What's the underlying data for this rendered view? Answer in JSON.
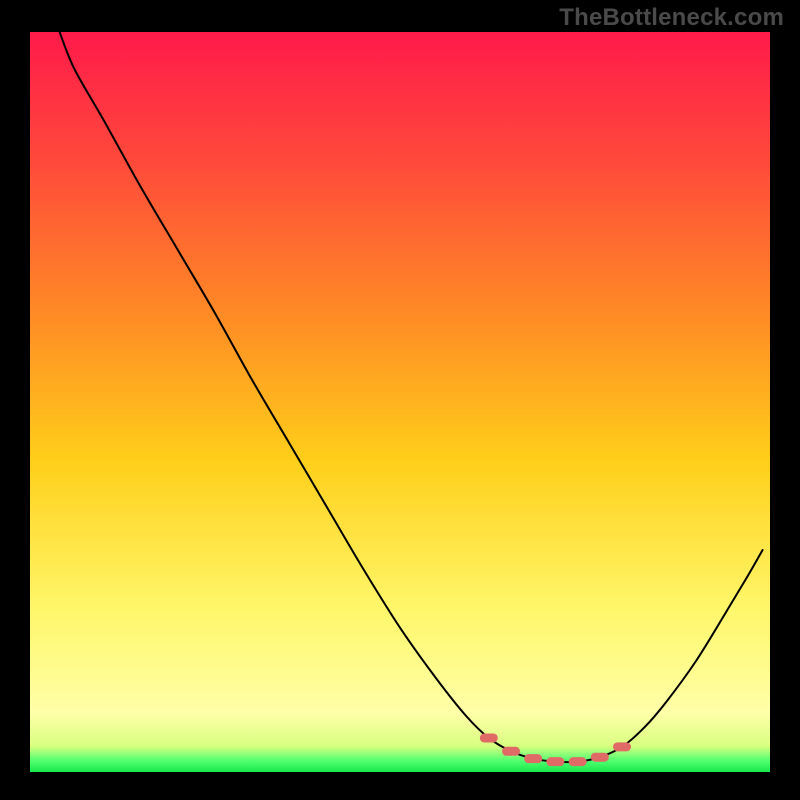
{
  "watermark": "TheBottleneck.com",
  "colors": {
    "bg_black": "#000000",
    "grad_top": "#ff1a4a",
    "grad_mid1": "#ff6a2a",
    "grad_mid2": "#ffd21a",
    "grad_low": "#fff76a",
    "grad_bottom_yellow": "#ffffa0",
    "grad_green": "#2bff62",
    "curve": "#000000",
    "marker": "#e06a66",
    "watermark": "#4a4a4a"
  },
  "chart_data": {
    "type": "line",
    "title": "",
    "xlabel": "",
    "ylabel": "",
    "xlim": [
      0,
      100
    ],
    "ylim": [
      0,
      100
    ],
    "grid": false,
    "legend": false,
    "annotations": [],
    "axes_visible": false,
    "curve": [
      {
        "x": 4.0,
        "y": 100.0
      },
      {
        "x": 6.0,
        "y": 95.0
      },
      {
        "x": 10.0,
        "y": 88.0
      },
      {
        "x": 15.0,
        "y": 79.0
      },
      {
        "x": 20.0,
        "y": 70.5
      },
      {
        "x": 25.0,
        "y": 62.0
      },
      {
        "x": 30.0,
        "y": 53.0
      },
      {
        "x": 35.0,
        "y": 44.5
      },
      {
        "x": 40.0,
        "y": 36.0
      },
      {
        "x": 45.0,
        "y": 27.5
      },
      {
        "x": 50.0,
        "y": 19.5
      },
      {
        "x": 55.0,
        "y": 12.5
      },
      {
        "x": 59.0,
        "y": 7.5
      },
      {
        "x": 62.0,
        "y": 4.6
      },
      {
        "x": 65.0,
        "y": 2.8
      },
      {
        "x": 68.0,
        "y": 1.8
      },
      {
        "x": 71.0,
        "y": 1.4
      },
      {
        "x": 74.0,
        "y": 1.4
      },
      {
        "x": 77.0,
        "y": 2.0
      },
      {
        "x": 80.0,
        "y": 3.4
      },
      {
        "x": 83.0,
        "y": 6.0
      },
      {
        "x": 86.0,
        "y": 9.5
      },
      {
        "x": 90.0,
        "y": 15.0
      },
      {
        "x": 94.0,
        "y": 21.5
      },
      {
        "x": 97.0,
        "y": 26.5
      },
      {
        "x": 99.0,
        "y": 30.0
      }
    ],
    "markers": [
      {
        "x": 62.0,
        "y": 4.6
      },
      {
        "x": 65.0,
        "y": 2.8
      },
      {
        "x": 68.0,
        "y": 1.8
      },
      {
        "x": 71.0,
        "y": 1.4
      },
      {
        "x": 74.0,
        "y": 1.4
      },
      {
        "x": 77.0,
        "y": 2.0
      },
      {
        "x": 80.0,
        "y": 3.4
      }
    ],
    "background_gradient": {
      "direction": "vertical",
      "stops": [
        {
          "offset": 0.0,
          "color": "#ff1a4a"
        },
        {
          "offset": 0.18,
          "color": "#ff4b3a"
        },
        {
          "offset": 0.38,
          "color": "#ff8a25"
        },
        {
          "offset": 0.58,
          "color": "#ffcf1a"
        },
        {
          "offset": 0.78,
          "color": "#fff76a"
        },
        {
          "offset": 0.92,
          "color": "#ffffa8"
        },
        {
          "offset": 0.965,
          "color": "#d8ff80"
        },
        {
          "offset": 0.985,
          "color": "#50ff70"
        },
        {
          "offset": 1.0,
          "color": "#18e84a"
        }
      ]
    }
  }
}
